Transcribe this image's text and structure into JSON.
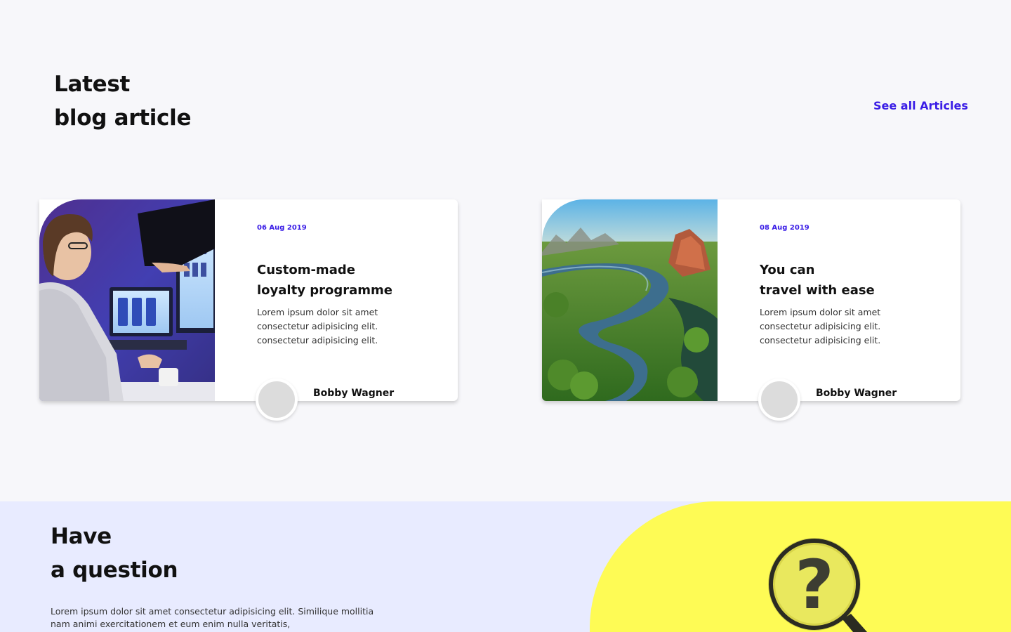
{
  "blog": {
    "title_line1": "Latest",
    "title_line2": "blog article",
    "see_all_label": "See all Articles",
    "articles": [
      {
        "date": "06 Aug 2019",
        "title_line1": "Custom-made",
        "title_line2": "loyalty programme",
        "text_line1": "Lorem ipsum dolor sit amet",
        "text_line2": "consectetur adipisicing elit.",
        "text_line3": "consectetur adipisicing elit.",
        "author": "Bobby Wagner"
      },
      {
        "date": "08 Aug 2019",
        "title_line1": "You can",
        "title_line2": "travel with ease",
        "text_line1": "Lorem ipsum dolor sit amet",
        "text_line2": "consectetur adipisicing elit.",
        "text_line3": "consectetur adipisicing elit.",
        "author": "Bobby Wagner"
      }
    ]
  },
  "question": {
    "title_line1": "Have",
    "title_line2": "a question",
    "text_line1": "Lorem ipsum dolor sit amet consectetur adipisicing elit. Similique mollitia",
    "text_line2": "nam animi exercitationem et eum enim nulla veritatis,"
  },
  "colors": {
    "accent": "#3a1de6",
    "page_background": "#f7f7fa",
    "question_background": "#e8ebff",
    "highlight_yellow": "#fefb55"
  },
  "icons": {
    "question_image": "magnifier-question-mark-icon"
  }
}
